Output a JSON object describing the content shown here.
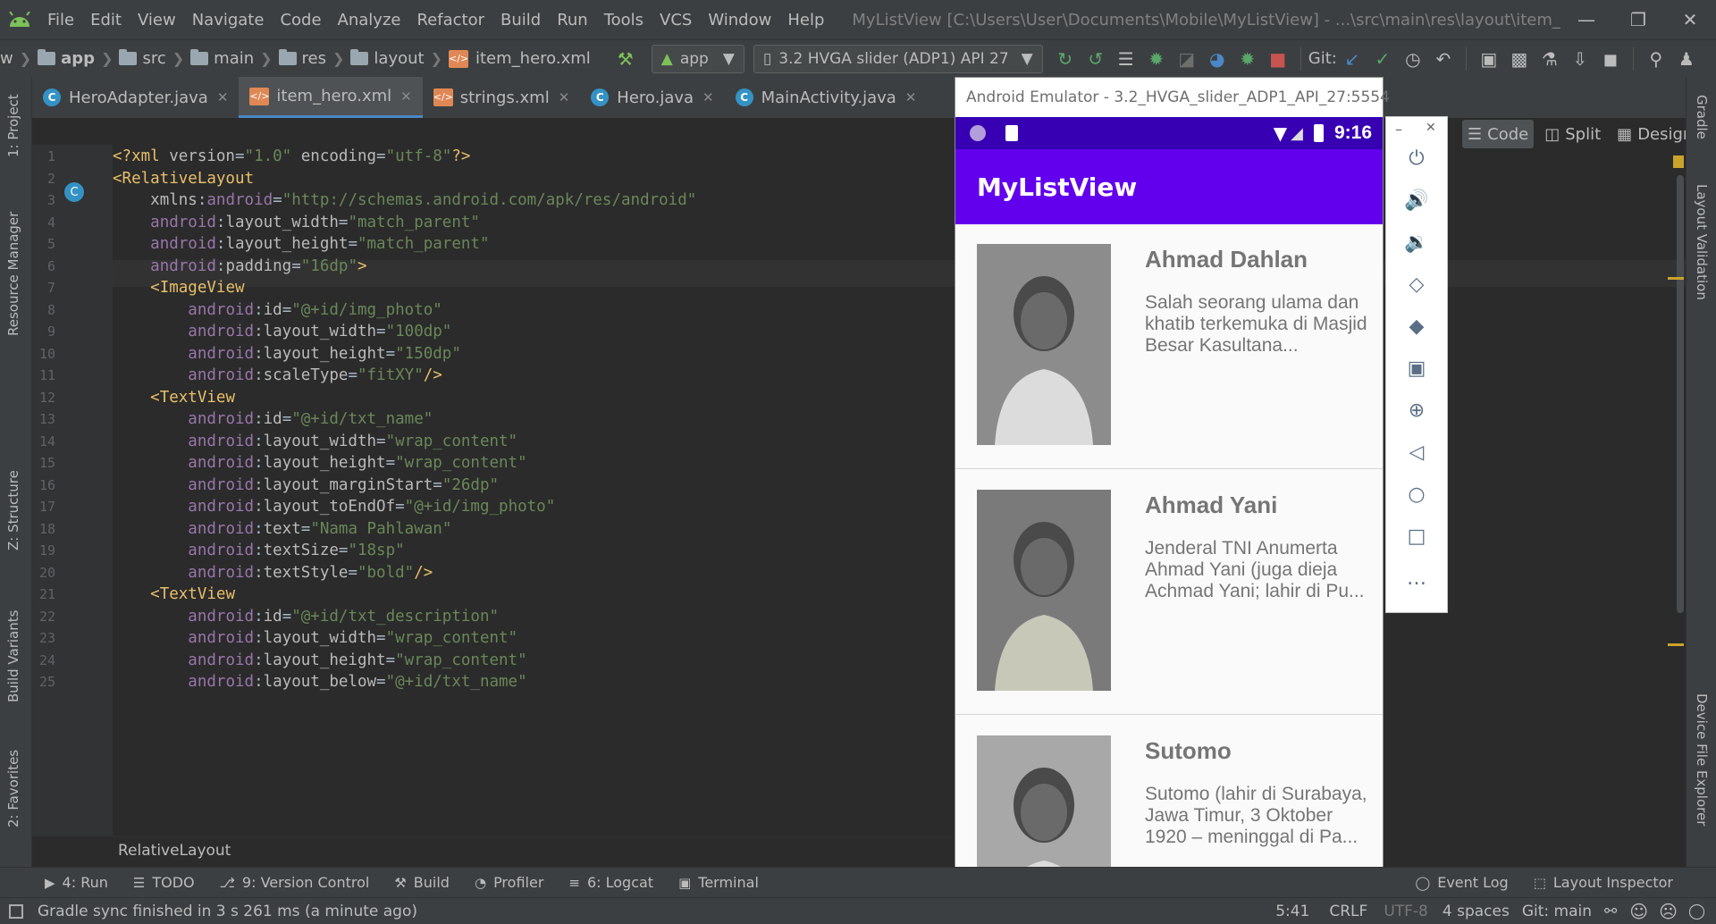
{
  "menu": {
    "items": [
      "File",
      "Edit",
      "View",
      "Navigate",
      "Code",
      "Analyze",
      "Refactor",
      "Build",
      "Run",
      "Tools",
      "VCS",
      "Window",
      "Help"
    ],
    "window_title": "MyListView [C:\\Users\\User\\Documents\\Mobile\\MyListView] - ...\\src\\main\\res\\layout\\item_hero.xml [app]"
  },
  "nav": {
    "crumbs": [
      "w",
      "app",
      "src",
      "main",
      "res",
      "layout",
      "item_hero.xml"
    ],
    "run_config": "app",
    "device": "3.2  HVGA slider (ADP1) API 27",
    "git_label": "Git:"
  },
  "tabs": [
    {
      "label": "HeroAdapter.java",
      "type": "java"
    },
    {
      "label": "item_hero.xml",
      "type": "xml",
      "active": true
    },
    {
      "label": "strings.xml",
      "type": "xml"
    },
    {
      "label": "Hero.java",
      "type": "java"
    },
    {
      "label": "MainActivity.java",
      "type": "java"
    }
  ],
  "view_modes": [
    "Code",
    "Split",
    "Design"
  ],
  "left_tools": [
    "1: Project",
    "Resource Manager",
    "Z: Structure",
    "Build Variants",
    "2: Favorites"
  ],
  "right_tools": [
    "Gradle",
    "Layout Validation",
    "Device File Explorer"
  ],
  "code_lines": [
    {
      "n": "1",
      "parts": [
        [
          "tag",
          "<?xml "
        ],
        [
          "attr",
          "version"
        ],
        [
          "plain",
          "="
        ],
        [
          "val",
          "\"1.0\""
        ],
        [
          "attr",
          " encoding"
        ],
        [
          "plain",
          "="
        ],
        [
          "val",
          "\"utf-8\""
        ],
        [
          "tag",
          "?>"
        ]
      ]
    },
    {
      "n": "2",
      "parts": [
        [
          "tag",
          "<RelativeLayout"
        ]
      ]
    },
    {
      "n": "3",
      "parts": [
        [
          "plain",
          "    "
        ],
        [
          "attr",
          "xmlns"
        ],
        [
          "plain",
          ":"
        ],
        [
          "ns",
          "android"
        ],
        [
          "plain",
          "="
        ],
        [
          "val",
          "\"http://schemas.android.com/apk/res/android\""
        ]
      ]
    },
    {
      "n": "4",
      "parts": [
        [
          "plain",
          "    "
        ],
        [
          "ns",
          "android"
        ],
        [
          "plain",
          ":"
        ],
        [
          "attr",
          "layout_width"
        ],
        [
          "plain",
          "="
        ],
        [
          "val",
          "\"match_parent\""
        ]
      ]
    },
    {
      "n": "5",
      "parts": [
        [
          "plain",
          "    "
        ],
        [
          "ns",
          "android"
        ],
        [
          "plain",
          ":"
        ],
        [
          "attr",
          "layout_height"
        ],
        [
          "plain",
          "="
        ],
        [
          "val",
          "\"match_parent\""
        ]
      ]
    },
    {
      "n": "6",
      "parts": [
        [
          "plain",
          "    "
        ],
        [
          "ns",
          "android"
        ],
        [
          "plain",
          ":"
        ],
        [
          "attr",
          "padding"
        ],
        [
          "plain",
          "="
        ],
        [
          "val",
          "\"16dp\""
        ],
        [
          "tag",
          ">"
        ]
      ]
    },
    {
      "n": "7",
      "parts": [
        [
          "plain",
          "    "
        ],
        [
          "tag",
          "<ImageView"
        ]
      ]
    },
    {
      "n": "8",
      "parts": [
        [
          "plain",
          "        "
        ],
        [
          "ns",
          "android"
        ],
        [
          "plain",
          ":"
        ],
        [
          "attr",
          "id"
        ],
        [
          "plain",
          "="
        ],
        [
          "val",
          "\"@+id/img_photo\""
        ]
      ]
    },
    {
      "n": "9",
      "parts": [
        [
          "plain",
          "        "
        ],
        [
          "ns",
          "android"
        ],
        [
          "plain",
          ":"
        ],
        [
          "attr",
          "layout_width"
        ],
        [
          "plain",
          "="
        ],
        [
          "val",
          "\"100dp\""
        ]
      ]
    },
    {
      "n": "10",
      "parts": [
        [
          "plain",
          "        "
        ],
        [
          "ns",
          "android"
        ],
        [
          "plain",
          ":"
        ],
        [
          "attr",
          "layout_height"
        ],
        [
          "plain",
          "="
        ],
        [
          "val",
          "\"150dp\""
        ]
      ]
    },
    {
      "n": "11",
      "parts": [
        [
          "plain",
          "        "
        ],
        [
          "ns",
          "android"
        ],
        [
          "plain",
          ":"
        ],
        [
          "attr",
          "scaleType"
        ],
        [
          "plain",
          "="
        ],
        [
          "val",
          "\"fitXY\""
        ],
        [
          "tag",
          "/>"
        ]
      ]
    },
    {
      "n": "12",
      "parts": [
        [
          "plain",
          "    "
        ],
        [
          "tag",
          "<TextView"
        ]
      ]
    },
    {
      "n": "13",
      "parts": [
        [
          "plain",
          "        "
        ],
        [
          "ns",
          "android"
        ],
        [
          "plain",
          ":"
        ],
        [
          "attr",
          "id"
        ],
        [
          "plain",
          "="
        ],
        [
          "val",
          "\"@+id/txt_name\""
        ]
      ]
    },
    {
      "n": "14",
      "parts": [
        [
          "plain",
          "        "
        ],
        [
          "ns",
          "android"
        ],
        [
          "plain",
          ":"
        ],
        [
          "attr",
          "layout_width"
        ],
        [
          "plain",
          "="
        ],
        [
          "val",
          "\"wrap_content\""
        ]
      ]
    },
    {
      "n": "15",
      "parts": [
        [
          "plain",
          "        "
        ],
        [
          "ns",
          "android"
        ],
        [
          "plain",
          ":"
        ],
        [
          "attr",
          "layout_height"
        ],
        [
          "plain",
          "="
        ],
        [
          "val",
          "\"wrap_content\""
        ]
      ]
    },
    {
      "n": "16",
      "parts": [
        [
          "plain",
          "        "
        ],
        [
          "ns",
          "android"
        ],
        [
          "plain",
          ":"
        ],
        [
          "attr",
          "layout_marginStart"
        ],
        [
          "plain",
          "="
        ],
        [
          "val",
          "\"26dp\""
        ]
      ]
    },
    {
      "n": "17",
      "parts": [
        [
          "plain",
          "        "
        ],
        [
          "ns",
          "android"
        ],
        [
          "plain",
          ":"
        ],
        [
          "attr",
          "layout_toEndOf"
        ],
        [
          "plain",
          "="
        ],
        [
          "val",
          "\"@+id/img_photo\""
        ]
      ]
    },
    {
      "n": "18",
      "parts": [
        [
          "plain",
          "        "
        ],
        [
          "ns",
          "android"
        ],
        [
          "plain",
          ":"
        ],
        [
          "attr",
          "text"
        ],
        [
          "plain",
          "="
        ],
        [
          "val",
          "\"Nama Pahlawan\""
        ]
      ]
    },
    {
      "n": "19",
      "parts": [
        [
          "plain",
          "        "
        ],
        [
          "ns",
          "android"
        ],
        [
          "plain",
          ":"
        ],
        [
          "attr",
          "textSize"
        ],
        [
          "plain",
          "="
        ],
        [
          "val",
          "\"18sp\""
        ]
      ]
    },
    {
      "n": "20",
      "parts": [
        [
          "plain",
          "        "
        ],
        [
          "ns",
          "android"
        ],
        [
          "plain",
          ":"
        ],
        [
          "attr",
          "textStyle"
        ],
        [
          "plain",
          "="
        ],
        [
          "val",
          "\"bold\""
        ],
        [
          "tag",
          "/>"
        ]
      ]
    },
    {
      "n": "21",
      "parts": [
        [
          "plain",
          "    "
        ],
        [
          "tag",
          "<TextView"
        ]
      ]
    },
    {
      "n": "22",
      "parts": [
        [
          "plain",
          "        "
        ],
        [
          "ns",
          "android"
        ],
        [
          "plain",
          ":"
        ],
        [
          "attr",
          "id"
        ],
        [
          "plain",
          "="
        ],
        [
          "val",
          "\"@+id/txt_description\""
        ]
      ]
    },
    {
      "n": "23",
      "parts": [
        [
          "plain",
          "        "
        ],
        [
          "ns",
          "android"
        ],
        [
          "plain",
          ":"
        ],
        [
          "attr",
          "layout_width"
        ],
        [
          "plain",
          "="
        ],
        [
          "val",
          "\"wrap_content\""
        ]
      ]
    },
    {
      "n": "24",
      "parts": [
        [
          "plain",
          "        "
        ],
        [
          "ns",
          "android"
        ],
        [
          "plain",
          ":"
        ],
        [
          "attr",
          "layout_height"
        ],
        [
          "plain",
          "="
        ],
        [
          "val",
          "\"wrap_content\""
        ]
      ]
    },
    {
      "n": "25",
      "parts": [
        [
          "plain",
          "        "
        ],
        [
          "ns",
          "android"
        ],
        [
          "plain",
          ":"
        ],
        [
          "attr",
          "layout_below"
        ],
        [
          "plain",
          "="
        ],
        [
          "val",
          "\"@+id/txt_name\""
        ]
      ]
    }
  ],
  "code_breadcrumb": "RelativeLayout",
  "bottom_tools": [
    {
      "label": "4: Run",
      "icon": "run-icon"
    },
    {
      "label": "TODO",
      "icon": "list-icon"
    },
    {
      "label": "9: Version Control",
      "icon": "vcs-icon"
    },
    {
      "label": "Build",
      "icon": "hammer-icon"
    },
    {
      "label": "Profiler",
      "icon": "gauge-icon"
    },
    {
      "label": "6: Logcat",
      "icon": "logcat-icon"
    },
    {
      "label": "Terminal",
      "icon": "terminal-icon"
    }
  ],
  "bottom_right_tools": [
    {
      "label": "Event Log",
      "icon": "event-log-icon"
    },
    {
      "label": "Layout Inspector",
      "icon": "inspector-icon"
    }
  ],
  "status": {
    "message": "Gradle sync finished in 3 s 261 ms (a minute ago)",
    "position": "5:41",
    "line_sep": "CRLF",
    "encoding": "UTF-8",
    "indent": "4 spaces",
    "branch": "Git: main"
  },
  "emulator": {
    "window_title": "Android Emulator - 3.2_HVGA_slider_ADP1_API_27:5554",
    "time": "9:16",
    "app_title": "MyListView",
    "heroes": [
      {
        "name": "Ahmad Dahlan",
        "desc": "Salah seorang ulama dan khatib terkemuka di Masjid Besar Kasultana..."
      },
      {
        "name": "Ahmad Yani",
        "desc": "Jenderal TNI Anumerta Ahmad Yani (juga dieja Achmad Yani; lahir di Pu..."
      },
      {
        "name": "Sutomo",
        "desc": "Sutomo (lahir di Surabaya, Jawa Timur, 3 Oktober 1920 – meninggal di Pa..."
      }
    ],
    "panel_buttons": [
      "power-icon",
      "volume-up-icon",
      "volume-down-icon",
      "rotate-left-icon",
      "rotate-right-icon",
      "camera-icon",
      "zoom-icon",
      "back-icon",
      "home-icon",
      "overview-icon",
      "more-icon"
    ]
  },
  "colors": {
    "accent": "#4a88c7",
    "app_bar": "#6200ee",
    "status_bar": "#3700b3"
  }
}
